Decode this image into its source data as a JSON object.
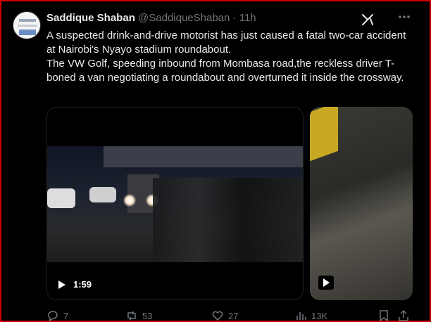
{
  "tweet": {
    "author_name": "Saddique Shaban",
    "author_handle": "@SaddiqueShaban",
    "separator": "·",
    "time_ago": "11h",
    "body": "A suspected drink-and-drive motorist has just caused a fatal two-car accident at Nairobi's Nyayo stadium roundabout.\nThe VW Golf, speeding inbound from Mombasa road,the reckless driver T-boned a van negotiating a roundabout and overturned it inside the crossway."
  },
  "media": {
    "video_duration": "1:59"
  },
  "actions": {
    "replies": "7",
    "reposts": "53",
    "likes": "27",
    "views": "13K"
  },
  "icons": {
    "grok": "grok-icon",
    "more": "more-icon",
    "reply": "reply-icon",
    "repost": "repost-icon",
    "like": "like-icon",
    "views": "views-icon",
    "bookmark": "bookmark-icon",
    "share": "share-icon",
    "play": "play-icon"
  },
  "colors": {
    "background": "#000000",
    "text": "#e7e9ea",
    "muted": "#71767b",
    "frame": "#d40000"
  }
}
